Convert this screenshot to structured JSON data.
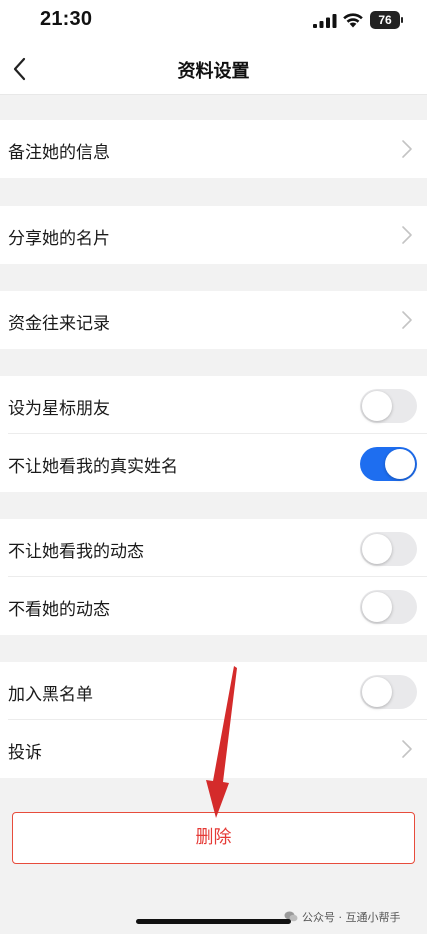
{
  "status_bar": {
    "time": "21:30",
    "battery": "76"
  },
  "nav": {
    "back_icon": "chevron-left-icon",
    "title": "资料设置"
  },
  "rows": {
    "remark": "备注她的信息",
    "share_card": "分享她的名片",
    "funds_record": "资金往来记录",
    "star_friend": "设为星标朋友",
    "hide_real_name": "不让她看我的真实姓名",
    "hide_my_moments": "不让她看我的动态",
    "hide_her_moments": "不看她的动态",
    "blacklist": "加入黑名单",
    "report": "投诉"
  },
  "toggles": {
    "star_friend": false,
    "hide_real_name": true,
    "hide_my_moments": false,
    "hide_her_moments": false,
    "blacklist": false
  },
  "delete_label": "删除",
  "watermark": "公众号 · 互通小帮手",
  "colors": {
    "toggle_on": "#1e6ef0",
    "delete_red": "#e53935",
    "arrow_red": "#d42b2b",
    "background": "#f2f2f2"
  }
}
